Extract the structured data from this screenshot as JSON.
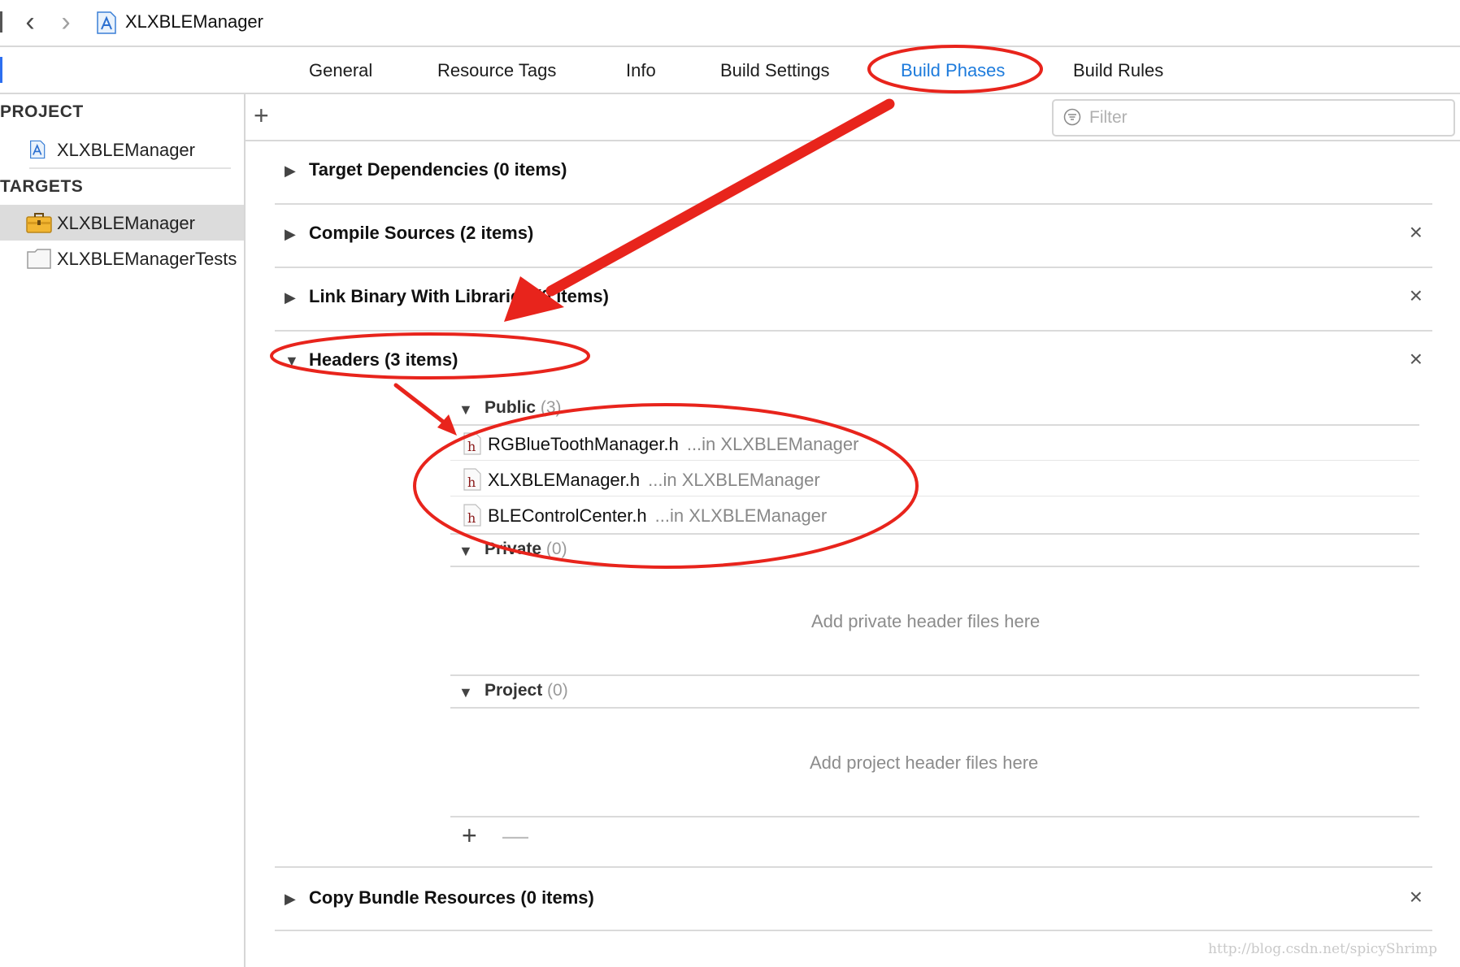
{
  "jumpbar": {
    "back_glyph": "‹",
    "forward_glyph": "›",
    "project_label": "XLXBLEManager",
    "icons": [
      "chevron-left-icon",
      "chevron-right-icon",
      "xcode-project-icon"
    ]
  },
  "tabs": [
    {
      "label": "General",
      "active": false
    },
    {
      "label": "Resource Tags",
      "active": false
    },
    {
      "label": "Info",
      "active": false
    },
    {
      "label": "Build Settings",
      "active": false
    },
    {
      "label": "Build Phases",
      "active": true
    },
    {
      "label": "Build Rules",
      "active": false
    }
  ],
  "sidebar": {
    "project_heading": "PROJECT",
    "project_item": "XLXBLEManager",
    "targets_heading": "TARGETS",
    "targets": [
      {
        "label": "XLXBLEManager",
        "selected": true,
        "icon": "app-target-icon"
      },
      {
        "label": "XLXBLEManagerTests",
        "selected": false,
        "icon": "test-bundle-icon"
      }
    ]
  },
  "toolbar": {
    "add_glyph": "+",
    "filter_placeholder": "Filter"
  },
  "phases": {
    "target_dependencies": "Target Dependencies (0 items)",
    "compile_sources": "Compile Sources (2 items)",
    "link_binary": "Link Binary With Libraries (0 items)",
    "headers": "Headers (3 items)",
    "copy_bundle": "Copy Bundle Resources (0 items)",
    "close_glyph": "×",
    "collapsed_glyph": "▶",
    "expanded_glyph": "▼"
  },
  "headers": {
    "public": {
      "label": "Public",
      "count": "(3)"
    },
    "files": [
      {
        "name": "RGBlueToothManager.h",
        "location": "...in XLXBLEManager"
      },
      {
        "name": "XLXBLEManager.h",
        "location": "...in XLXBLEManager"
      },
      {
        "name": "BLEControlCenter.h",
        "location": "...in XLXBLEManager"
      }
    ],
    "private": {
      "label": "Private",
      "count": "(0)"
    },
    "private_empty": "Add private header files here",
    "project": {
      "label": "Project",
      "count": "(0)"
    },
    "project_empty": "Add project header files here",
    "add_glyph": "+",
    "remove_glyph": "—"
  },
  "watermark": "http://blog.csdn.net/spicyShrimp",
  "colors": {
    "accent": "#1d7bdc",
    "annotation_red": "#e8241c",
    "header_file_glyph": "#8b1a1a"
  }
}
